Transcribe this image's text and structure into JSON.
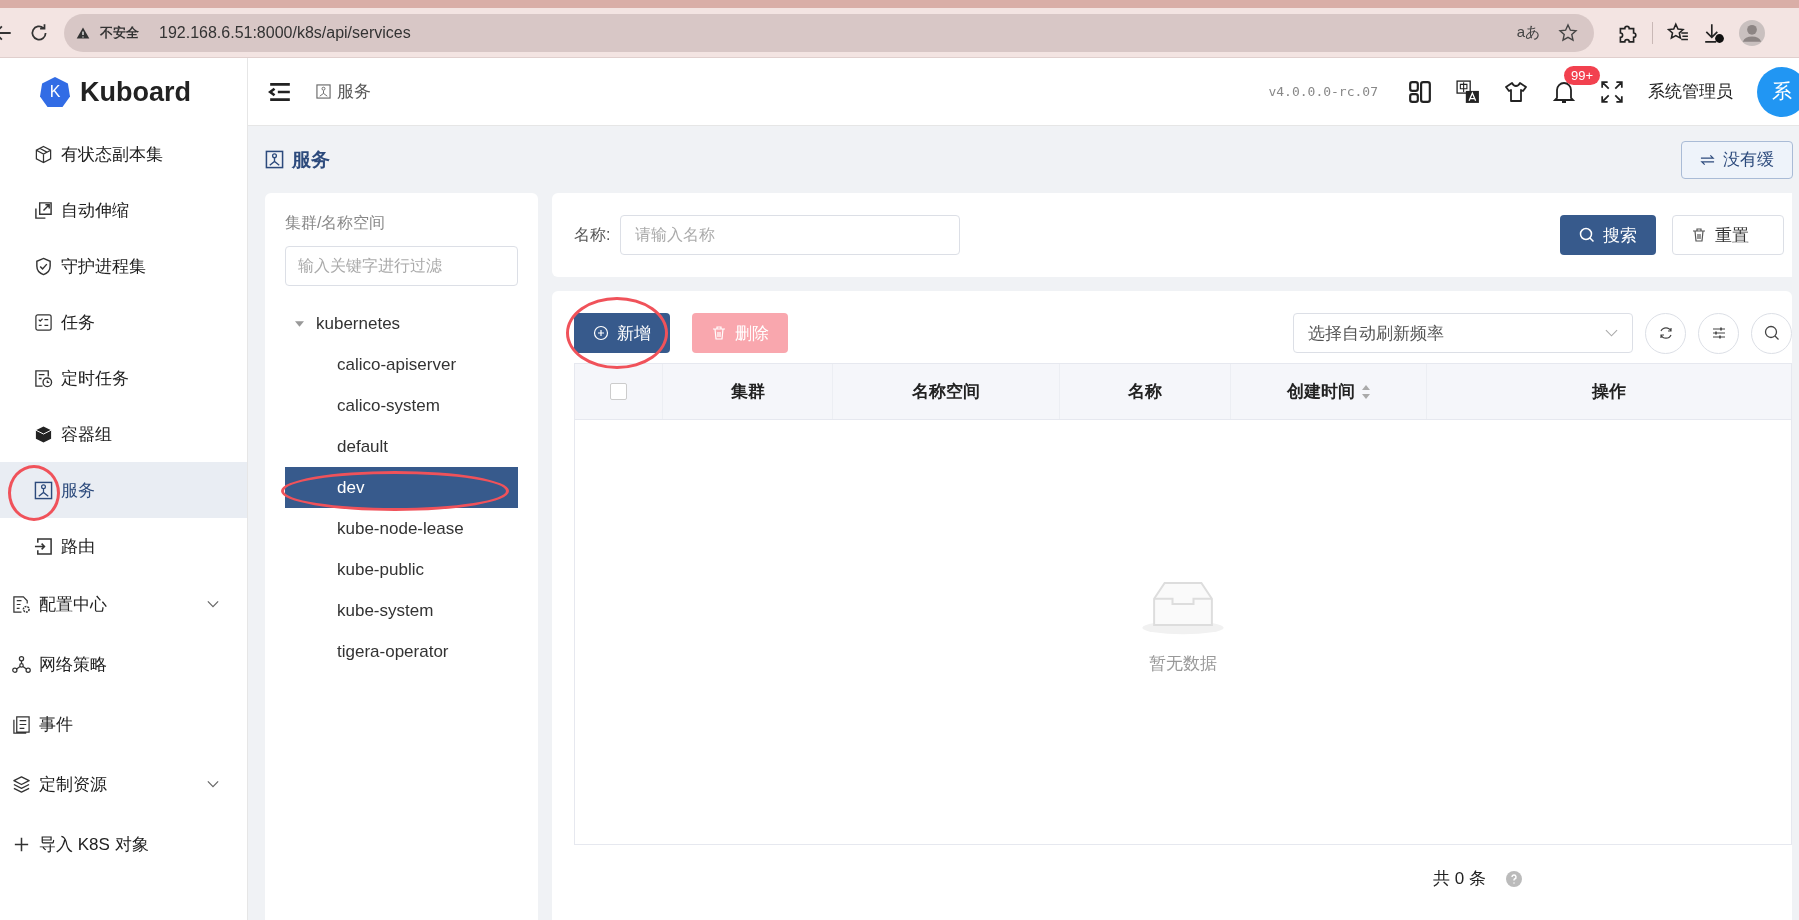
{
  "browser": {
    "security_label": "不安全",
    "url": "192.168.6.51:8000/k8s/api/services",
    "read_aloud_glyph": "aあ"
  },
  "header": {
    "logo_letter": "K",
    "logo": "Kuboard",
    "breadcrumb": "服务",
    "version": "v4.0.0.0-rc.07",
    "notification_badge": "99+",
    "user": "系统管理员",
    "avatar": "系"
  },
  "sidebar": {
    "items": [
      {
        "label": "有状态副本集",
        "kind": "child",
        "selected": false,
        "circled": false
      },
      {
        "label": "自动伸缩",
        "kind": "child",
        "selected": false,
        "circled": false
      },
      {
        "label": "守护进程集",
        "kind": "child",
        "selected": false,
        "circled": false
      },
      {
        "label": "任务",
        "kind": "child",
        "selected": false,
        "circled": false
      },
      {
        "label": "定时任务",
        "kind": "child",
        "selected": false,
        "circled": false
      },
      {
        "label": "容器组",
        "kind": "child",
        "selected": false,
        "circled": false
      },
      {
        "label": "服务",
        "kind": "child",
        "selected": true,
        "circled": true
      },
      {
        "label": "路由",
        "kind": "child",
        "selected": false,
        "circled": false
      },
      {
        "label": "配置中心",
        "kind": "group",
        "selected": false,
        "circled": false
      },
      {
        "label": "网络策略",
        "kind": "link",
        "selected": false,
        "circled": false
      },
      {
        "label": "事件",
        "kind": "link",
        "selected": false,
        "circled": false
      },
      {
        "label": "定制资源",
        "kind": "group",
        "selected": false,
        "circled": false
      },
      {
        "label": "导入 K8S 对象",
        "kind": "link",
        "selected": false,
        "circled": false
      }
    ]
  },
  "page_title": "服务",
  "cache_button": "没有缓",
  "tree": {
    "title": "集群/名称空间",
    "filter_placeholder": "输入关键字进行过滤",
    "root": {
      "label": "kubernetes",
      "expanded": true,
      "children": [
        {
          "label": "calico-apiserver",
          "selected": false,
          "circled": false
        },
        {
          "label": "calico-system",
          "selected": false,
          "circled": false
        },
        {
          "label": "default",
          "selected": false,
          "circled": false
        },
        {
          "label": "dev",
          "selected": true,
          "circled": true
        },
        {
          "label": "kube-node-lease",
          "selected": false,
          "circled": false
        },
        {
          "label": "kube-public",
          "selected": false,
          "circled": false
        },
        {
          "label": "kube-system",
          "selected": false,
          "circled": false
        },
        {
          "label": "tigera-operator",
          "selected": false,
          "circled": false
        }
      ]
    }
  },
  "search": {
    "label": "名称:",
    "placeholder": "请输入名称",
    "search_button": "搜索",
    "reset_button": "重置"
  },
  "toolbar": {
    "add_button": {
      "label": "新增",
      "circled": true
    },
    "delete_button": {
      "label": "删除",
      "disabled": true
    },
    "refresh_placeholder": "选择自动刷新频率"
  },
  "table": {
    "columns": [
      {
        "label": "集群",
        "sortable": false
      },
      {
        "label": "名称空间",
        "sortable": false
      },
      {
        "label": "名称",
        "sortable": false
      },
      {
        "label": "创建时间",
        "sortable": true
      },
      {
        "label": "操作",
        "sortable": false
      }
    ],
    "select_all_checked": false,
    "empty_text": "暂无数据"
  },
  "pagination": {
    "total": "共 0 条"
  }
}
